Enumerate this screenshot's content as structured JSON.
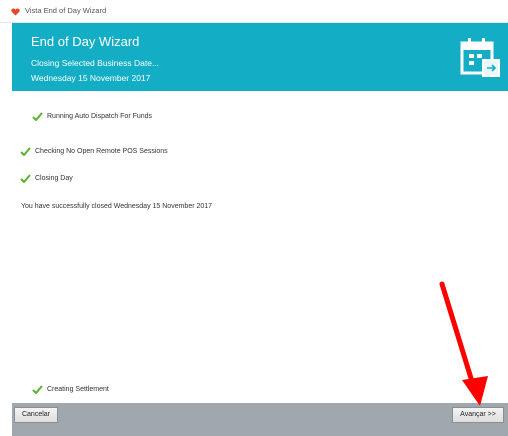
{
  "window": {
    "title": "Vista End of Day Wizard"
  },
  "banner": {
    "title": "End of Day Wizard",
    "subtitle": "Closing Selected Business Date...",
    "date": "Wednesday 15 November 2017",
    "icon": "calendar-icon",
    "color": "#13aec6"
  },
  "steps": [
    {
      "label": "Running Auto Dispatch For Funds",
      "status": "done"
    },
    {
      "label": "Checking No Open Remote POS Sessions",
      "status": "done"
    },
    {
      "label": "Closing Day",
      "status": "done"
    },
    {
      "label": "Creating Settlement",
      "status": "done"
    }
  ],
  "message": "You have successfully closed Wednesday 15 November 2017",
  "footer": {
    "cancel_label": "Cancelar",
    "next_label": "Avançar >>"
  },
  "annotation": {
    "icon": "red-arrow-icon",
    "color": "#ff0000"
  }
}
